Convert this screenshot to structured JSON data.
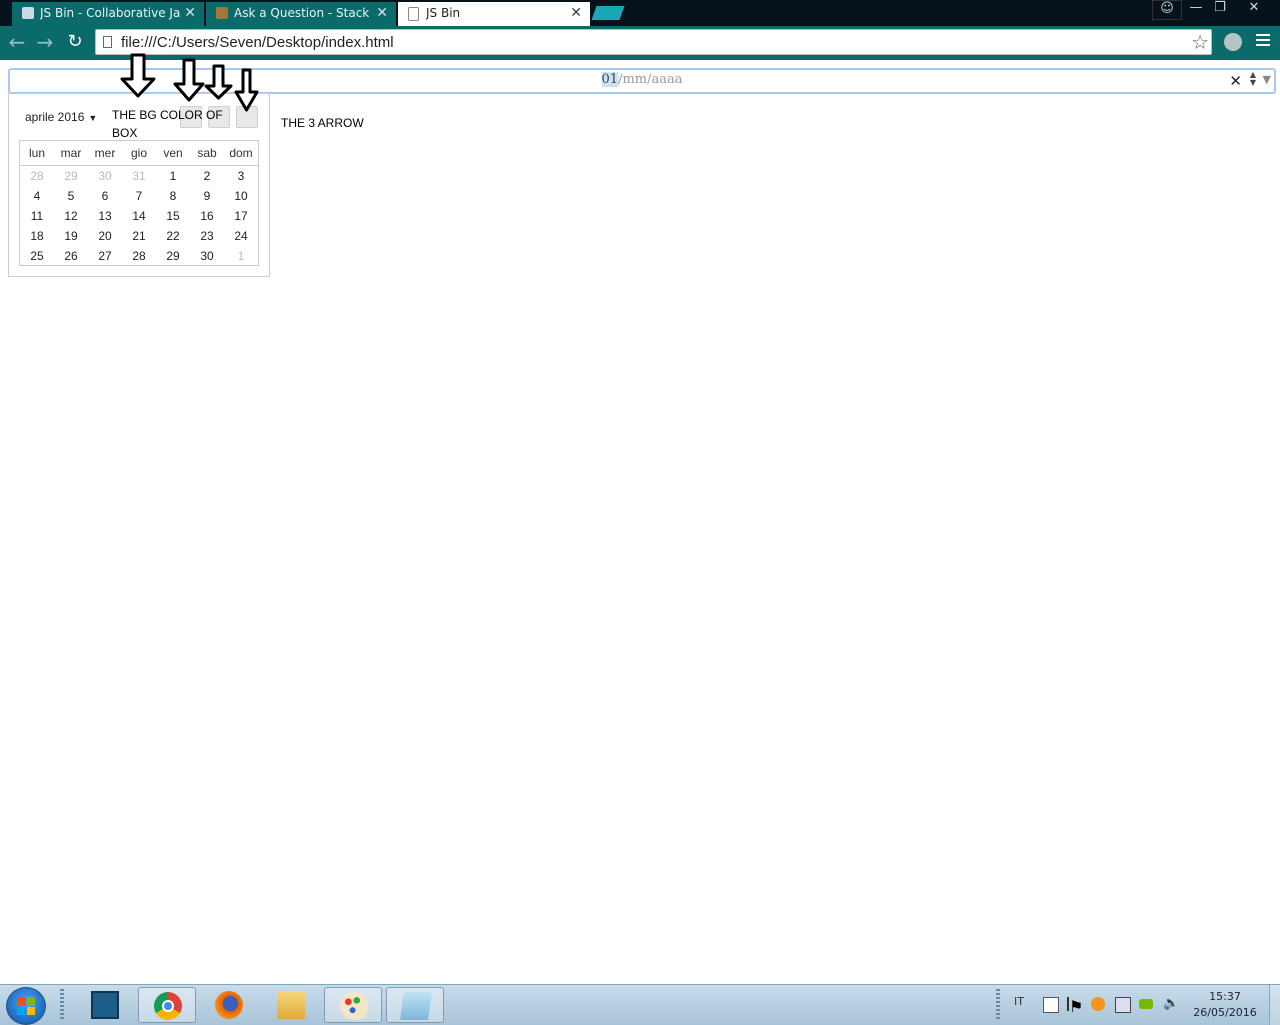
{
  "browser": {
    "tabs": [
      {
        "label": "JS Bin - Collaborative Java",
        "favicon": "jsbin-icon",
        "active": false
      },
      {
        "label": "Ask a Question - Stack Ov",
        "favicon": "stackoverflow-icon",
        "active": false
      },
      {
        "label": "JS Bin",
        "favicon": "page-icon",
        "active": true
      }
    ],
    "close_glyph": "✕",
    "url": "file:///C:/Users/Seven/Desktop/index.html",
    "window_buttons": [
      "user-icon",
      "minimize-icon",
      "restore-icon",
      "close-icon"
    ]
  },
  "date_input": {
    "day": "01",
    "rest": "/mm/aaaa",
    "clear_glyph": "✕",
    "spin_up": "▲",
    "spin_down": "▼",
    "dropdown_glyph": "▼"
  },
  "picker": {
    "month_label": "aprile 2016",
    "caret": "▼",
    "weekdays": [
      "lun",
      "mar",
      "mer",
      "gio",
      "ven",
      "sab",
      "dom"
    ],
    "weeks": [
      [
        {
          "d": "28",
          "m": true
        },
        {
          "d": "29",
          "m": true
        },
        {
          "d": "30",
          "m": true
        },
        {
          "d": "31",
          "m": true
        },
        {
          "d": "1"
        },
        {
          "d": "2"
        },
        {
          "d": "3"
        }
      ],
      [
        {
          "d": "4"
        },
        {
          "d": "5"
        },
        {
          "d": "6"
        },
        {
          "d": "7"
        },
        {
          "d": "8"
        },
        {
          "d": "9"
        },
        {
          "d": "10"
        }
      ],
      [
        {
          "d": "11"
        },
        {
          "d": "12"
        },
        {
          "d": "13"
        },
        {
          "d": "14"
        },
        {
          "d": "15"
        },
        {
          "d": "16"
        },
        {
          "d": "17"
        }
      ],
      [
        {
          "d": "18"
        },
        {
          "d": "19"
        },
        {
          "d": "20"
        },
        {
          "d": "21"
        },
        {
          "d": "22"
        },
        {
          "d": "23"
        },
        {
          "d": "24"
        }
      ],
      [
        {
          "d": "25"
        },
        {
          "d": "26"
        },
        {
          "d": "27"
        },
        {
          "d": "28"
        },
        {
          "d": "29"
        },
        {
          "d": "30"
        },
        {
          "d": "1",
          "m": true
        }
      ]
    ]
  },
  "annotations": {
    "bg_box_label": "THE BG COLOR OF BOX",
    "arrow_label": "THE 3 ARROW"
  },
  "taskbar": {
    "apps": [
      "brackets-icon",
      "chrome-icon",
      "firefox-icon",
      "explorer-icon",
      "paint-icon",
      "notepad-icon"
    ],
    "language": "IT",
    "time": "15:37",
    "date": "26/05/2016"
  }
}
